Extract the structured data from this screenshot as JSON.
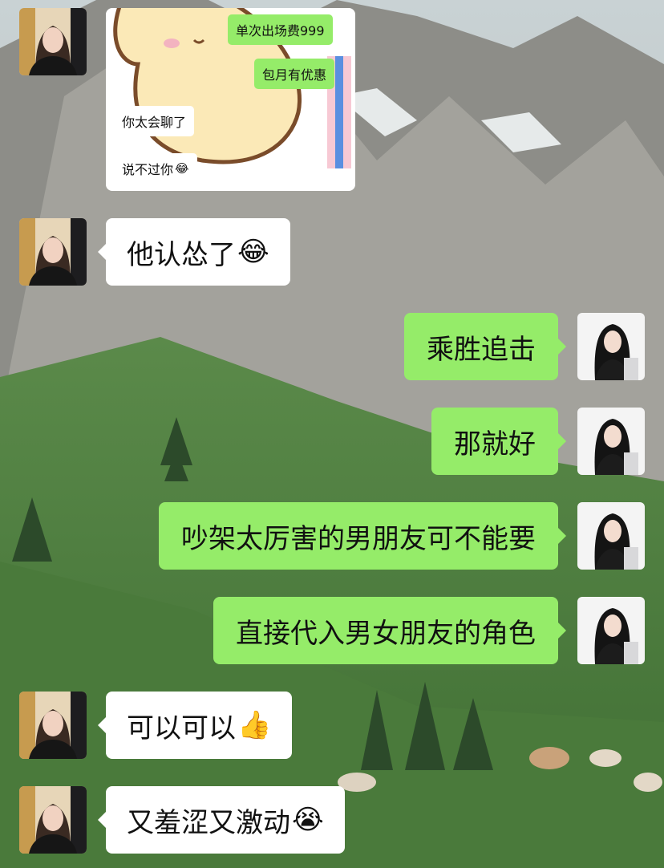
{
  "screenshot": {
    "messages": [
      {
        "side": "right",
        "text": "单次出场费999"
      },
      {
        "side": "right",
        "text": "包月有优惠"
      },
      {
        "side": "left",
        "text": "你太会聊了"
      },
      {
        "side": "left",
        "text": "说不过你"
      }
    ]
  },
  "chat": {
    "messages": [
      {
        "side": "left",
        "text": "他认怂了",
        "emoji": "😂"
      },
      {
        "side": "right",
        "text": "乘胜追击"
      },
      {
        "side": "right",
        "text": "那就好"
      },
      {
        "side": "right",
        "text": "吵架太厉害的男朋友可不能要"
      },
      {
        "side": "right",
        "text": "直接代入男女朋友的角色"
      },
      {
        "side": "left",
        "text": "可以可以",
        "emoji": "👍"
      },
      {
        "side": "left",
        "text": "又羞涩又激动",
        "emoji": "😭"
      }
    ]
  },
  "colors": {
    "bubble_green": "#95ec69",
    "bubble_white": "#ffffff"
  }
}
